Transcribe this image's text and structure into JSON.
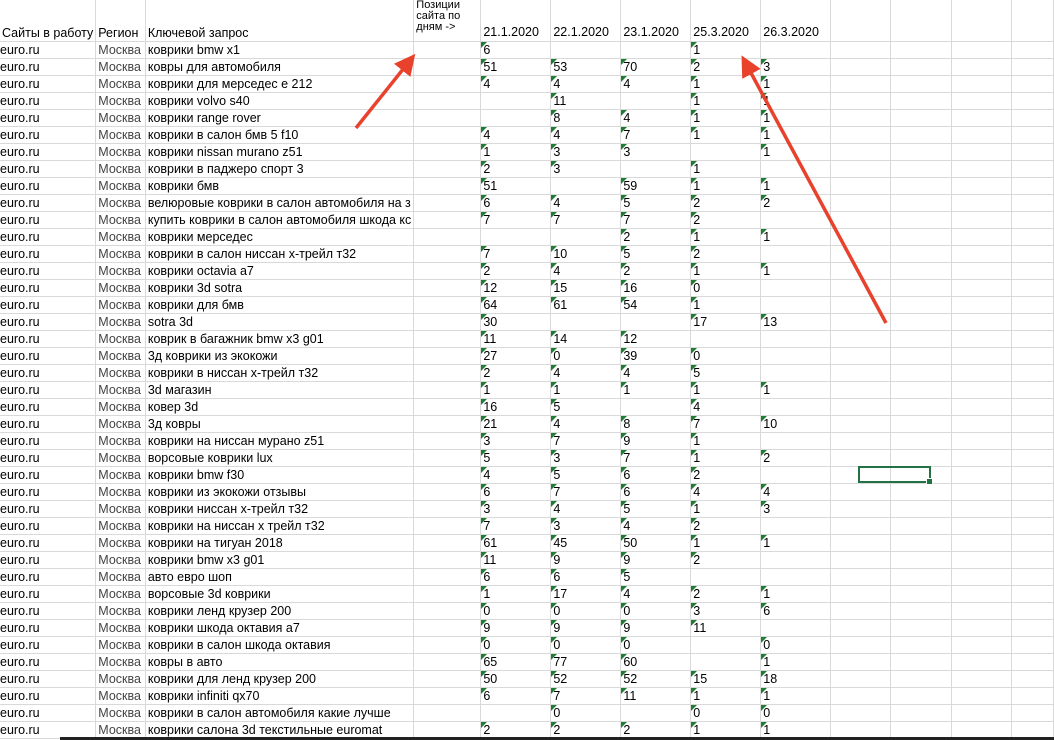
{
  "headers": {
    "site": "Сайты в работу",
    "region": "Регион",
    "keyword": "Ключевой запрос",
    "positions": "Позиции сайта по дням ->",
    "dates": [
      "21.1.2020",
      "22.1.2020",
      "23.1.2020",
      "25.3.2020",
      "26.3.2020"
    ]
  },
  "colors": {
    "arrow": "#e8412c",
    "selection": "#217346",
    "comment_marker": "#1e7d32"
  },
  "rows": [
    {
      "site": "euro.ru",
      "region": "Москва",
      "keyword": "коврики bmw x1",
      "v": [
        "6",
        "",
        "",
        "1",
        ""
      ]
    },
    {
      "site": "euro.ru",
      "region": "Москва",
      "keyword": "ковры для автомобиля",
      "v": [
        "51",
        "53",
        "70",
        "2",
        "3"
      ]
    },
    {
      "site": "euro.ru",
      "region": "Москва",
      "keyword": "коврики для мерседес е 212",
      "v": [
        "4",
        "4",
        "4",
        "1",
        "1"
      ]
    },
    {
      "site": "euro.ru",
      "region": "Москва",
      "keyword": "коврики volvo s40",
      "v": [
        "",
        "11",
        "",
        "1",
        "1"
      ]
    },
    {
      "site": "euro.ru",
      "region": "Москва",
      "keyword": "коврики range rover",
      "v": [
        "",
        "8",
        "4",
        "1",
        "1"
      ]
    },
    {
      "site": "euro.ru",
      "region": "Москва",
      "keyword": "коврики в салон бмв 5 f10",
      "v": [
        "4",
        "4",
        "7",
        "1",
        "1"
      ]
    },
    {
      "site": "euro.ru",
      "region": "Москва",
      "keyword": "коврики nissan murano z51",
      "v": [
        "1",
        "3",
        "3",
        "",
        "1"
      ]
    },
    {
      "site": "euro.ru",
      "region": "Москва",
      "keyword": "коврики в паджеро спорт 3",
      "v": [
        "2",
        "3",
        "",
        "1",
        ""
      ]
    },
    {
      "site": "euro.ru",
      "region": "Москва",
      "keyword": "коврики бмв",
      "v": [
        "51",
        "",
        "59",
        "1",
        "1"
      ]
    },
    {
      "site": "euro.ru",
      "region": "Москва",
      "keyword": "велюровые коврики в салон автомобиля на з",
      "v": [
        "6",
        "4",
        "5",
        "2",
        "2"
      ]
    },
    {
      "site": "euro.ru",
      "region": "Москва",
      "keyword": "купить коврики в салон автомобиля шкода кс",
      "v": [
        "7",
        "7",
        "7",
        "2",
        ""
      ]
    },
    {
      "site": "euro.ru",
      "region": "Москва",
      "keyword": "коврики мерседес",
      "v": [
        "",
        "",
        "2",
        "1",
        "1"
      ]
    },
    {
      "site": "euro.ru",
      "region": "Москва",
      "keyword": "коврики в салон ниссан х-трейл т32",
      "v": [
        "7",
        "10",
        "5",
        "2",
        ""
      ]
    },
    {
      "site": "euro.ru",
      "region": "Москва",
      "keyword": "коврики octavia a7",
      "v": [
        "2",
        "4",
        "2",
        "1",
        "1"
      ]
    },
    {
      "site": "euro.ru",
      "region": "Москва",
      "keyword": "коврики 3d sotra",
      "v": [
        "12",
        "15",
        "16",
        "0",
        ""
      ]
    },
    {
      "site": "euro.ru",
      "region": "Москва",
      "keyword": "коврики для бмв",
      "v": [
        "64",
        "61",
        "54",
        "1",
        ""
      ]
    },
    {
      "site": "euro.ru",
      "region": "Москва",
      "keyword": "sotra 3d",
      "v": [
        "30",
        "",
        "",
        "17",
        "13"
      ]
    },
    {
      "site": "euro.ru",
      "region": "Москва",
      "keyword": "коврик в багажник bmw x3 g01",
      "v": [
        "11",
        "14",
        "12",
        "",
        ""
      ]
    },
    {
      "site": "euro.ru",
      "region": "Москва",
      "keyword": "3д коврики из экокожи",
      "v": [
        "27",
        "0",
        "39",
        "0",
        ""
      ]
    },
    {
      "site": "euro.ru",
      "region": "Москва",
      "keyword": "коврики в ниссан х-трейл т32",
      "v": [
        "2",
        "4",
        "4",
        "5",
        ""
      ]
    },
    {
      "site": "euro.ru",
      "region": "Москва",
      "keyword": "3d магазин",
      "v": [
        "1",
        "1",
        "1",
        "1",
        "1"
      ]
    },
    {
      "site": "euro.ru",
      "region": "Москва",
      "keyword": "ковер 3d",
      "v": [
        "16",
        "5",
        "",
        "4",
        ""
      ]
    },
    {
      "site": "euro.ru",
      "region": "Москва",
      "keyword": "3д ковры",
      "v": [
        "21",
        "4",
        "8",
        "7",
        "10"
      ]
    },
    {
      "site": "euro.ru",
      "region": "Москва",
      "keyword": "коврики на ниссан мурано z51",
      "v": [
        "3",
        "7",
        "9",
        "1",
        ""
      ]
    },
    {
      "site": "euro.ru",
      "region": "Москва",
      "keyword": "ворсовые коврики lux",
      "v": [
        "5",
        "3",
        "7",
        "1",
        "2"
      ]
    },
    {
      "site": "euro.ru",
      "region": "Москва",
      "keyword": "коврики bmw f30",
      "v": [
        "4",
        "5",
        "6",
        "2",
        ""
      ]
    },
    {
      "site": "euro.ru",
      "region": "Москва",
      "keyword": "коврики из экокожи отзывы",
      "v": [
        "6",
        "7",
        "6",
        "4",
        "4"
      ]
    },
    {
      "site": "euro.ru",
      "region": "Москва",
      "keyword": "коврики ниссан х-трейл т32",
      "v": [
        "3",
        "4",
        "5",
        "1",
        "3"
      ]
    },
    {
      "site": "euro.ru",
      "region": "Москва",
      "keyword": "коврики на ниссан х трейл т32",
      "v": [
        "7",
        "3",
        "4",
        "2",
        ""
      ]
    },
    {
      "site": "euro.ru",
      "region": "Москва",
      "keyword": "коврики на тигуан 2018",
      "v": [
        "61",
        "45",
        "50",
        "1",
        "1"
      ]
    },
    {
      "site": "euro.ru",
      "region": "Москва",
      "keyword": "коврики bmw x3 g01",
      "v": [
        "11",
        "9",
        "9",
        "2",
        ""
      ]
    },
    {
      "site": "euro.ru",
      "region": "Москва",
      "keyword": "авто евро шоп",
      "v": [
        "6",
        "6",
        "5",
        "",
        ""
      ]
    },
    {
      "site": "euro.ru",
      "region": "Москва",
      "keyword": "ворсовые 3d коврики",
      "v": [
        "1",
        "17",
        "4",
        "2",
        "1"
      ]
    },
    {
      "site": "euro.ru",
      "region": "Москва",
      "keyword": "коврики ленд крузер 200",
      "v": [
        "0",
        "0",
        "0",
        "3",
        "6"
      ]
    },
    {
      "site": "euro.ru",
      "region": "Москва",
      "keyword": "коврики шкода октавия а7",
      "v": [
        "9",
        "9",
        "9",
        "11",
        ""
      ]
    },
    {
      "site": "euro.ru",
      "region": "Москва",
      "keyword": "коврики в салон шкода октавия",
      "v": [
        "0",
        "0",
        "0",
        "",
        "0"
      ]
    },
    {
      "site": "euro.ru",
      "region": "Москва",
      "keyword": "ковры в авто",
      "v": [
        "65",
        "77",
        "60",
        "",
        "1"
      ]
    },
    {
      "site": "euro.ru",
      "region": "Москва",
      "keyword": "коврики для ленд крузер 200",
      "v": [
        "50",
        "52",
        "52",
        "15",
        "18"
      ]
    },
    {
      "site": "euro.ru",
      "region": "Москва",
      "keyword": "коврики infiniti qx70",
      "v": [
        "6",
        "7",
        "11",
        "1",
        "1"
      ]
    },
    {
      "site": "euro.ru",
      "region": "Москва",
      "keyword": "коврики в салон автомобиля какие лучше",
      "v": [
        "",
        "0",
        "",
        "0",
        "0"
      ]
    },
    {
      "site": "euro.ru",
      "region": "Москва",
      "keyword": "коврики салона 3d текстильные euromat",
      "v": [
        "2",
        "2",
        "2",
        "1",
        "1"
      ]
    }
  ]
}
